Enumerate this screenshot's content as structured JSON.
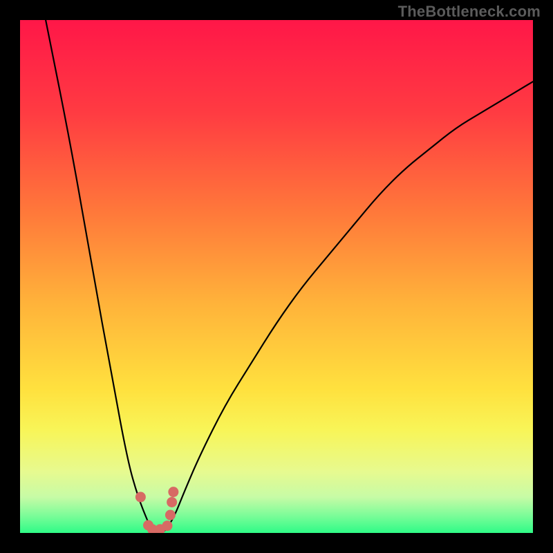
{
  "watermark": "TheBottleneck.com",
  "colors": {
    "frame": "#000000",
    "curve": "#000000",
    "marker": "#d76a64",
    "gradient_stops": [
      {
        "offset": 0.0,
        "color": "#ff1748"
      },
      {
        "offset": 0.18,
        "color": "#ff3b42"
      },
      {
        "offset": 0.38,
        "color": "#ff7a3a"
      },
      {
        "offset": 0.55,
        "color": "#ffb23a"
      },
      {
        "offset": 0.72,
        "color": "#ffe13e"
      },
      {
        "offset": 0.8,
        "color": "#f8f558"
      },
      {
        "offset": 0.88,
        "color": "#e7fa8f"
      },
      {
        "offset": 0.93,
        "color": "#c7fba6"
      },
      {
        "offset": 0.965,
        "color": "#7efc99"
      },
      {
        "offset": 1.0,
        "color": "#2ffb87"
      }
    ]
  },
  "chart_data": {
    "type": "line",
    "title": "",
    "xlabel": "",
    "ylabel": "",
    "xlim": [
      0,
      100
    ],
    "ylim": [
      0,
      100
    ],
    "grid": false,
    "legend": false,
    "series": [
      {
        "name": "bottleneck-curve",
        "x": [
          5,
          10,
          14,
          18,
          21,
          23,
          25,
          26,
          27,
          28,
          30,
          32,
          35,
          40,
          45,
          50,
          55,
          60,
          65,
          70,
          75,
          80,
          85,
          90,
          95,
          100
        ],
        "y": [
          100,
          75,
          52,
          30,
          14,
          7,
          2,
          0,
          0,
          0,
          3,
          8,
          15,
          25,
          33,
          41,
          48,
          54,
          60,
          66,
          71,
          75,
          79,
          82,
          85,
          88
        ]
      }
    ],
    "markers": {
      "name": "highlight-points",
      "points": [
        {
          "x": 23.5,
          "y": 7
        },
        {
          "x": 25.0,
          "y": 1.5
        },
        {
          "x": 25.8,
          "y": 0.7
        },
        {
          "x": 27.3,
          "y": 0.7
        },
        {
          "x": 28.7,
          "y": 1.4
        },
        {
          "x": 29.3,
          "y": 3.5
        },
        {
          "x": 29.6,
          "y": 6.0
        },
        {
          "x": 29.9,
          "y": 8.0
        }
      ]
    }
  }
}
